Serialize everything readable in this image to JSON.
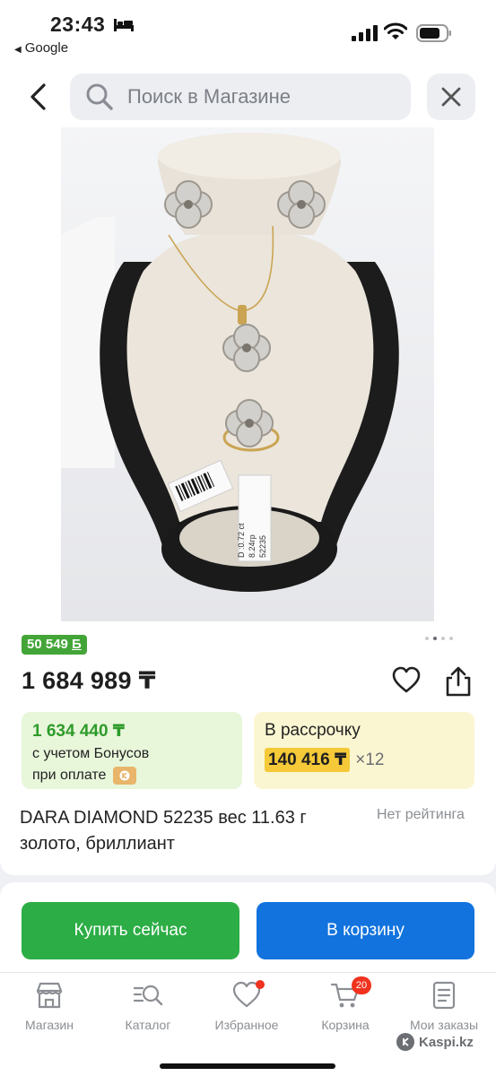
{
  "status_bar": {
    "time": "23:43",
    "back_app_label": "Google",
    "icons": [
      "bed-icon",
      "signal-icon",
      "wifi-icon",
      "battery-icon"
    ]
  },
  "search": {
    "placeholder": "Поиск в Магазине"
  },
  "product": {
    "image_labels": [
      "D :0.72 ct",
      "8.24гр",
      "52235"
    ],
    "bonus_badge": "50 549 ",
    "price": "1 684 989 ₸",
    "bonus_price": "1 634 440 ₸",
    "bonus_line1": "с учетом Бонусов",
    "bonus_line2": "при оплате",
    "installment_title": "В рассрочку",
    "installment_amount": "140 416 ₸",
    "installment_months": "×12",
    "title": "DARA DIAMOND 52235 вес 11.63 г золото, бриллиант",
    "rating": "Нет рейтинга",
    "gallery_active_index": 1,
    "gallery_count": 4
  },
  "actions": {
    "buy_now": "Купить сейчас",
    "add_to_cart": "В корзину"
  },
  "tabs": [
    {
      "label": "Магазин",
      "icon": "store-icon"
    },
    {
      "label": "Каталог",
      "icon": "catalog-icon"
    },
    {
      "label": "Избранное",
      "icon": "heart-icon"
    },
    {
      "label": "Корзина",
      "icon": "cart-icon",
      "badge": "20"
    },
    {
      "label": "Мои заказы",
      "icon": "orders-icon"
    }
  ],
  "watermark": "Kaspi.kz",
  "colors": {
    "green": "#2cad45",
    "blue": "#1273de",
    "bonus_green": "#43a538",
    "installment_yellow": "#f5c938",
    "badge_red": "#f0321e"
  }
}
